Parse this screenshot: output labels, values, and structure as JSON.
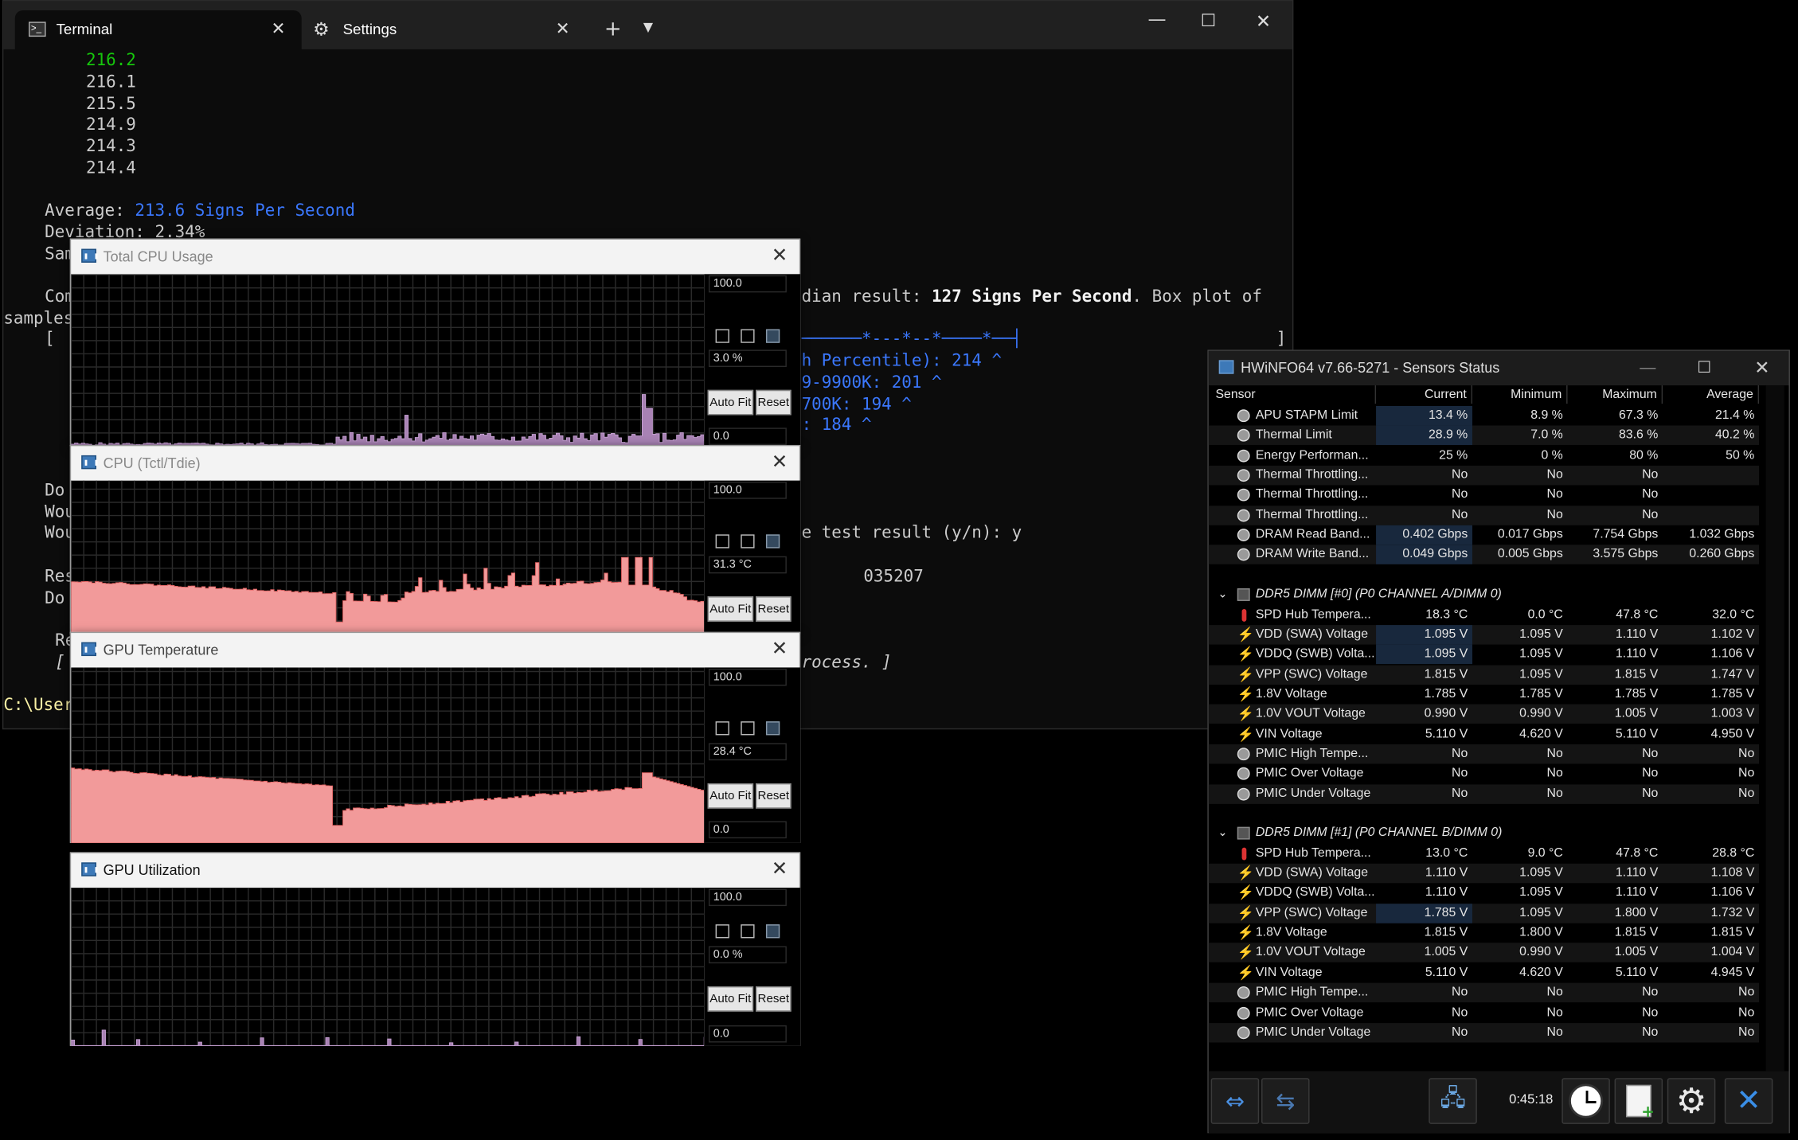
{
  "terminal": {
    "tabs": [
      {
        "label": "Terminal"
      },
      {
        "label": "Settings"
      }
    ],
    "lines": {
      "l1": "216.2",
      "l2": "216.1",
      "l3": "215.5",
      "l4": "214.9",
      "l5": "214.3",
      "l6": "214.4",
      "avg_label": "Average: ",
      "avg_value": "213.6 Signs Per Second",
      "dev": "Deviation: 2.34%",
      "sam": "Sam",
      "com": "Com",
      "median_pre": "dian result: ",
      "median_val": "127 Signs Per Second",
      "median_post": ". Box plot of",
      "samples": "samples",
      "bracket_open": "[",
      "bracket_close": "]",
      "boxplot": "──────*---*--*────*──┤",
      "pct": "h Percentile): 214 ^",
      "r1": "9-9900K: 201 ^",
      "r2": "700K: 194 ^",
      "r3": ": 184 ^",
      "do1": "Do",
      "wou1": "Wou",
      "wou2": "Wou",
      "test": "e test result (y/n): y",
      "res": "Res",
      "do2": "Do",
      "num": "035207",
      "re": "Re",
      "br2": "[",
      "process": "rocess. ]",
      "prompt": "C:\\User"
    }
  },
  "graphs": [
    {
      "title": "Total CPU Usage",
      "max": "100.0",
      "current": "3.0 %",
      "min": "0.0",
      "autofit": "Auto Fit",
      "reset": "Reset"
    },
    {
      "title": "CPU (Tctl/Tdie)",
      "max": "100.0",
      "current": "31.3 °C",
      "min": "0.0",
      "autofit": "Auto Fit",
      "reset": "Reset"
    },
    {
      "title": "GPU Temperature",
      "max": "100.0",
      "current": "28.4 °C",
      "min": "0.0",
      "autofit": "Auto Fit",
      "reset": "Reset"
    },
    {
      "title": "GPU Utilization",
      "max": "100.0",
      "current": "0.0 %",
      "min": "0.0",
      "autofit": "Auto Fit",
      "reset": "Reset"
    }
  ],
  "hwinfo": {
    "title": "HWiNFO64 v7.66-5271 - Sensors Status",
    "headers": [
      "Sensor",
      "Current",
      "Minimum",
      "Maximum",
      "Average"
    ],
    "rows1": [
      {
        "name": "APU STAPM Limit",
        "icon": "circle",
        "cur": "13.4 %",
        "min": "8.9 %",
        "max": "67.3 %",
        "avg": "21.4 %",
        "hl": true
      },
      {
        "name": "Thermal Limit",
        "icon": "circle",
        "cur": "28.9 %",
        "min": "7.0 %",
        "max": "83.6 %",
        "avg": "40.2 %",
        "hl": true
      },
      {
        "name": "Energy Performan...",
        "icon": "circle",
        "cur": "25 %",
        "min": "0 %",
        "max": "80 %",
        "avg": "50 %"
      },
      {
        "name": "Thermal Throttling...",
        "icon": "circle",
        "cur": "No",
        "min": "No",
        "max": "No",
        "avg": ""
      },
      {
        "name": "Thermal Throttling...",
        "icon": "circle",
        "cur": "No",
        "min": "No",
        "max": "No",
        "avg": ""
      },
      {
        "name": "Thermal Throttling...",
        "icon": "circle",
        "cur": "No",
        "min": "No",
        "max": "No",
        "avg": ""
      },
      {
        "name": "DRAM Read Band...",
        "icon": "circle",
        "cur": "0.402 Gbps",
        "min": "0.017 Gbps",
        "max": "7.754 Gbps",
        "avg": "1.032 Gbps",
        "hl": true
      },
      {
        "name": "DRAM Write Band...",
        "icon": "circle",
        "cur": "0.049 Gbps",
        "min": "0.005 Gbps",
        "max": "3.575 Gbps",
        "avg": "0.260 Gbps",
        "hl": true
      }
    ],
    "group1": "DDR5 DIMM [#0] (P0 CHANNEL A/DIMM 0)",
    "rows2": [
      {
        "name": "SPD Hub Tempera...",
        "icon": "therm",
        "cur": "18.3 °C",
        "min": "0.0 °C",
        "max": "47.8 °C",
        "avg": "32.0 °C"
      },
      {
        "name": "VDD (SWA) Voltage",
        "icon": "bolt",
        "cur": "1.095 V",
        "min": "1.095 V",
        "max": "1.110 V",
        "avg": "1.102 V",
        "hl": true
      },
      {
        "name": "VDDQ (SWB) Volta...",
        "icon": "bolt",
        "cur": "1.095 V",
        "min": "1.095 V",
        "max": "1.110 V",
        "avg": "1.106 V",
        "hl": true
      },
      {
        "name": "VPP (SWC) Voltage",
        "icon": "bolt",
        "cur": "1.815 V",
        "min": "1.095 V",
        "max": "1.815 V",
        "avg": "1.747 V"
      },
      {
        "name": "1.8V Voltage",
        "icon": "bolt",
        "cur": "1.785 V",
        "min": "1.785 V",
        "max": "1.785 V",
        "avg": "1.785 V"
      },
      {
        "name": "1.0V VOUT Voltage",
        "icon": "bolt",
        "cur": "0.990 V",
        "min": "0.990 V",
        "max": "1.005 V",
        "avg": "1.003 V"
      },
      {
        "name": "VIN Voltage",
        "icon": "bolt",
        "cur": "5.110 V",
        "min": "4.620 V",
        "max": "5.110 V",
        "avg": "4.950 V"
      },
      {
        "name": "PMIC High Tempe...",
        "icon": "circle",
        "cur": "No",
        "min": "No",
        "max": "No",
        "avg": "No"
      },
      {
        "name": "PMIC Over Voltage",
        "icon": "circle",
        "cur": "No",
        "min": "No",
        "max": "No",
        "avg": "No"
      },
      {
        "name": "PMIC Under Voltage",
        "icon": "circle",
        "cur": "No",
        "min": "No",
        "max": "No",
        "avg": "No"
      }
    ],
    "group2": "DDR5 DIMM [#1] (P0 CHANNEL B/DIMM 0)",
    "rows3": [
      {
        "name": "SPD Hub Tempera...",
        "icon": "therm",
        "cur": "13.0 °C",
        "min": "9.0 °C",
        "max": "47.8 °C",
        "avg": "28.8 °C"
      },
      {
        "name": "VDD (SWA) Voltage",
        "icon": "bolt",
        "cur": "1.110 V",
        "min": "1.095 V",
        "max": "1.110 V",
        "avg": "1.108 V"
      },
      {
        "name": "VDDQ (SWB) Volta...",
        "icon": "bolt",
        "cur": "1.110 V",
        "min": "1.095 V",
        "max": "1.110 V",
        "avg": "1.106 V"
      },
      {
        "name": "VPP (SWC) Voltage",
        "icon": "bolt",
        "cur": "1.785 V",
        "min": "1.095 V",
        "max": "1.800 V",
        "avg": "1.732 V",
        "hl": true
      },
      {
        "name": "1.8V Voltage",
        "icon": "bolt",
        "cur": "1.815 V",
        "min": "1.800 V",
        "max": "1.815 V",
        "avg": "1.815 V"
      },
      {
        "name": "1.0V VOUT Voltage",
        "icon": "bolt",
        "cur": "1.005 V",
        "min": "0.990 V",
        "max": "1.005 V",
        "avg": "1.004 V"
      },
      {
        "name": "VIN Voltage",
        "icon": "bolt",
        "cur": "5.110 V",
        "min": "4.620 V",
        "max": "5.110 V",
        "avg": "4.945 V"
      },
      {
        "name": "PMIC High Tempe...",
        "icon": "circle",
        "cur": "No",
        "min": "No",
        "max": "No",
        "avg": "No"
      },
      {
        "name": "PMIC Over Voltage",
        "icon": "circle",
        "cur": "No",
        "min": "No",
        "max": "No",
        "avg": "No"
      },
      {
        "name": "PMIC Under Voltage",
        "icon": "circle",
        "cur": "No",
        "min": "No",
        "max": "No",
        "avg": "No"
      }
    ],
    "timer": "0:45:18"
  }
}
